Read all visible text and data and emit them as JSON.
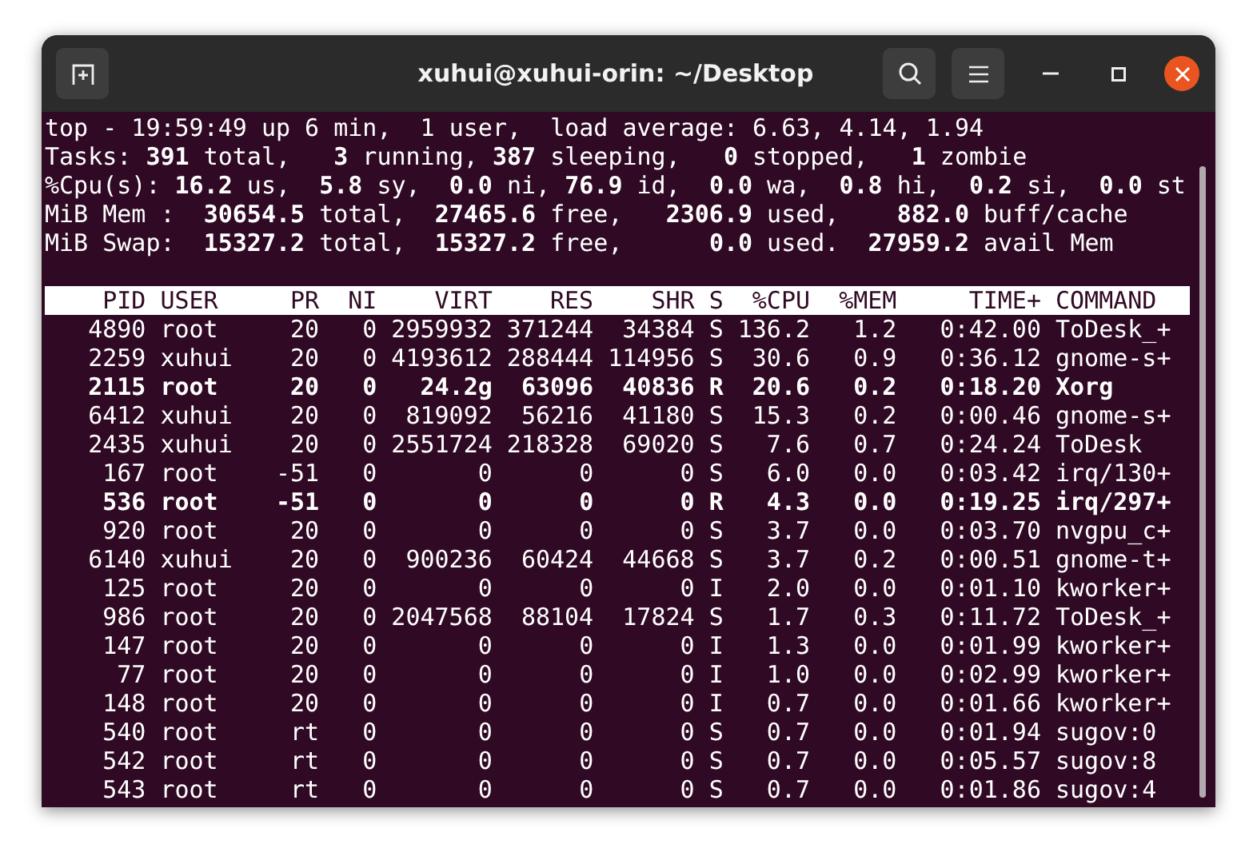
{
  "window": {
    "title": "xuhui@xuhui-orin: ~/Desktop"
  },
  "summary": [
    "top - 19:59:49 up 6 min,  1 user,  load average: 6.63, 4.14, 1.94",
    "Tasks: **391** total,   **3** running, **387** sleeping,   **0** stopped,   **1** zombie",
    "%Cpu(s): **16.2** us,  **5.8** sy,  **0.0** ni, **76.9** id,  **0.0** wa,  **0.8** hi,  **0.2** si,  **0.0** st",
    "MiB Mem :  **30654.5** total,  **27465.6** free,   **2306.9** used,    **882.0** buff/cache",
    "MiB Swap:  **15327.2** total,  **15327.2** free,      **0.0** used.  **27959.2** avail Mem"
  ],
  "table": {
    "columns": [
      "PID",
      "USER",
      "PR",
      "NI",
      "VIRT",
      "RES",
      "SHR",
      "S",
      "%CPU",
      "%MEM",
      "TIME+",
      "COMMAND"
    ],
    "rows": [
      {
        "cells": [
          "4890",
          "root",
          "20",
          "0",
          "2959932",
          "371244",
          "34384",
          "S",
          "136.2",
          "1.2",
          "0:42.00",
          "ToDesk_+"
        ],
        "highlighted": false
      },
      {
        "cells": [
          "2259",
          "xuhui",
          "20",
          "0",
          "4193612",
          "288444",
          "114956",
          "S",
          "30.6",
          "0.9",
          "0:36.12",
          "gnome-s+"
        ],
        "highlighted": false
      },
      {
        "cells": [
          "2115",
          "root",
          "20",
          "0",
          "24.2g",
          "63096",
          "40836",
          "R",
          "20.6",
          "0.2",
          "0:18.20",
          "Xorg"
        ],
        "highlighted": true
      },
      {
        "cells": [
          "6412",
          "xuhui",
          "20",
          "0",
          "819092",
          "56216",
          "41180",
          "S",
          "15.3",
          "0.2",
          "0:00.46",
          "gnome-s+"
        ],
        "highlighted": false
      },
      {
        "cells": [
          "2435",
          "xuhui",
          "20",
          "0",
          "2551724",
          "218328",
          "69020",
          "S",
          "7.6",
          "0.7",
          "0:24.24",
          "ToDesk"
        ],
        "highlighted": false
      },
      {
        "cells": [
          "167",
          "root",
          "-51",
          "0",
          "0",
          "0",
          "0",
          "S",
          "6.0",
          "0.0",
          "0:03.42",
          "irq/130+"
        ],
        "highlighted": false
      },
      {
        "cells": [
          "536",
          "root",
          "-51",
          "0",
          "0",
          "0",
          "0",
          "R",
          "4.3",
          "0.0",
          "0:19.25",
          "irq/297+"
        ],
        "highlighted": true
      },
      {
        "cells": [
          "920",
          "root",
          "20",
          "0",
          "0",
          "0",
          "0",
          "S",
          "3.7",
          "0.0",
          "0:03.70",
          "nvgpu_c+"
        ],
        "highlighted": false
      },
      {
        "cells": [
          "6140",
          "xuhui",
          "20",
          "0",
          "900236",
          "60424",
          "44668",
          "S",
          "3.7",
          "0.2",
          "0:00.51",
          "gnome-t+"
        ],
        "highlighted": false
      },
      {
        "cells": [
          "125",
          "root",
          "20",
          "0",
          "0",
          "0",
          "0",
          "I",
          "2.0",
          "0.0",
          "0:01.10",
          "kworker+"
        ],
        "highlighted": false
      },
      {
        "cells": [
          "986",
          "root",
          "20",
          "0",
          "2047568",
          "88104",
          "17824",
          "S",
          "1.7",
          "0.3",
          "0:11.72",
          "ToDesk_+"
        ],
        "highlighted": false
      },
      {
        "cells": [
          "147",
          "root",
          "20",
          "0",
          "0",
          "0",
          "0",
          "I",
          "1.3",
          "0.0",
          "0:01.99",
          "kworker+"
        ],
        "highlighted": false
      },
      {
        "cells": [
          "77",
          "root",
          "20",
          "0",
          "0",
          "0",
          "0",
          "I",
          "1.0",
          "0.0",
          "0:02.99",
          "kworker+"
        ],
        "highlighted": false
      },
      {
        "cells": [
          "148",
          "root",
          "20",
          "0",
          "0",
          "0",
          "0",
          "I",
          "0.7",
          "0.0",
          "0:01.66",
          "kworker+"
        ],
        "highlighted": false
      },
      {
        "cells": [
          "540",
          "root",
          "rt",
          "0",
          "0",
          "0",
          "0",
          "S",
          "0.7",
          "0.0",
          "0:01.94",
          "sugov:0"
        ],
        "highlighted": false
      },
      {
        "cells": [
          "542",
          "root",
          "rt",
          "0",
          "0",
          "0",
          "0",
          "S",
          "0.7",
          "0.0",
          "0:05.57",
          "sugov:8"
        ],
        "highlighted": false
      },
      {
        "cells": [
          "543",
          "root",
          "rt",
          "0",
          "0",
          "0",
          "0",
          "S",
          "0.7",
          "0.0",
          "0:01.86",
          "sugov:4"
        ],
        "highlighted": false
      }
    ]
  }
}
